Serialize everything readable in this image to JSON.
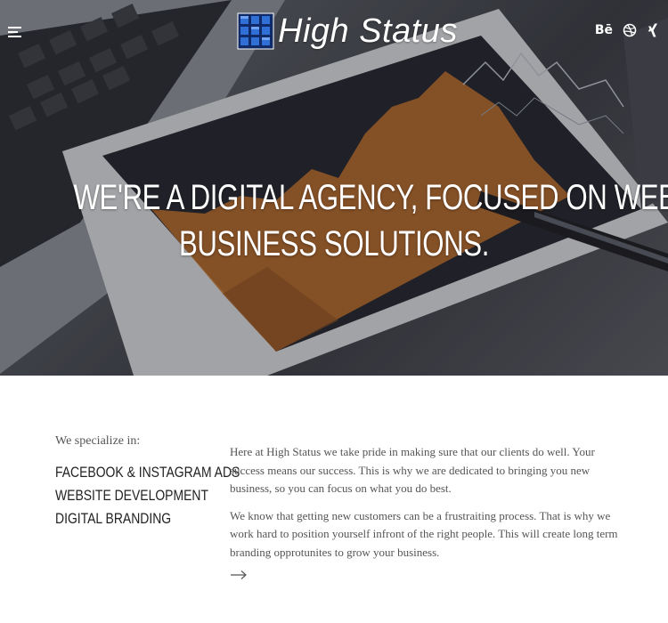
{
  "header": {
    "brand_name": "High Status",
    "social": [
      {
        "name": "behance-icon",
        "glyph": "Bē"
      },
      {
        "name": "dribbble-icon",
        "glyph": ""
      },
      {
        "name": "xing-icon",
        "glyph": ""
      }
    ]
  },
  "hero": {
    "heading_line1": "WE'RE A DIGITAL AGENCY, FOCUSED ON WEB BASED",
    "heading_line2": "BUSINESS SOLUTIONS."
  },
  "specialize": {
    "intro": "We specialize in:",
    "items": [
      "FACEBOOK & INSTAGRAM ADS",
      "WEBSITE DEVELOPMENT",
      "DIGITAL BRANDING"
    ]
  },
  "about": {
    "paragraph1": "Here at High Status we take pride in making sure that our clients do well. Your success means our success. This is why we are dedicated to bringing you new business, so you can focus on what you do best.",
    "paragraph2": "We know that getting new customers can be a frustraiting process. That is why we work hard to position yourself infront of the right people. This will create long term branding opprotunites to grow your business."
  },
  "colors": {
    "hero_text": "#ffffff",
    "body_text": "#555555",
    "heading_text": "#222222",
    "chart_orange": "#c8732a",
    "logo_blue": "#1f4fa8"
  }
}
